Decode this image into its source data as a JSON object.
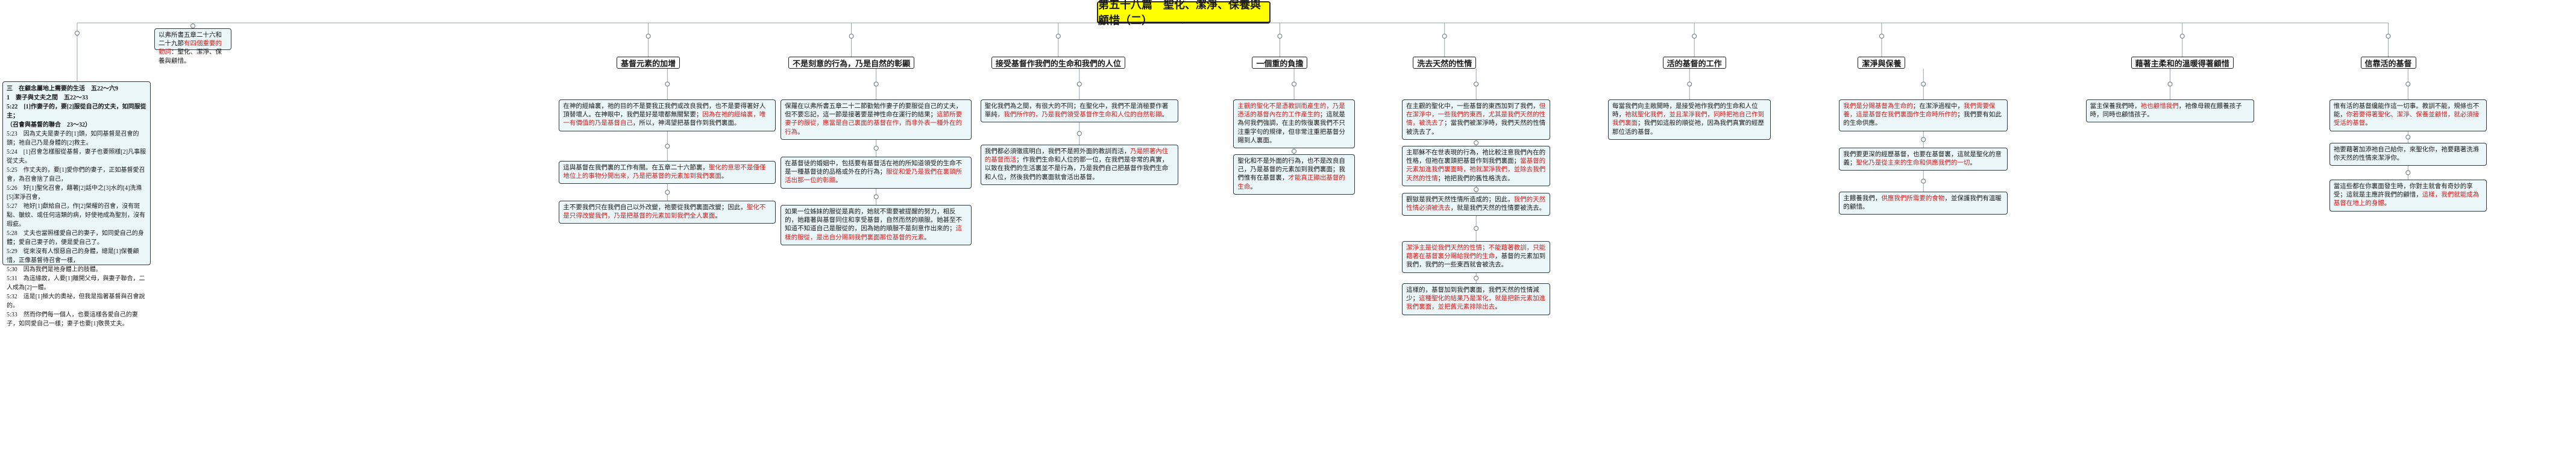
{
  "title": "第五十八篇　聖化、潔淨、保養與顧惜（二）",
  "left_block": {
    "lines": [
      "三　在顧念屬地上需要的生活　五22～六9",
      "1　妻子與丈夫之間　五22～33",
      "5:22　[1]作妻子的，要[2]服從自己的丈夫，如同服從主；",
      "（召會與基督的聯合　23～32）",
      "5:23　因為丈夫是妻子的[1]頭，如同基督是召會的頭；祂自己乃是身體的[2]救主。",
      "5:24　[1]召會怎樣服從基督，妻子也要照樣[2]凡事服從丈夫。",
      "5:25　作丈夫的，要[1]愛你們的妻子，正如基督愛召會，為召會捨了自己，",
      "5:26　好[1]聖化召會，藉著[2]話中之[3]水的[4]洗滌[5]潔淨召會，",
      "5:27　祂好[1]獻給自己，作[2]榮耀的召會，沒有斑點、皺紋、或任何這類的病，好使祂成為聖別，沒有瑕疵。",
      "5:28　丈夫也當照樣愛自己的妻子，如同愛自己的身體；愛自己妻子的，便是愛自己了。",
      "5:29　從來沒有人恨惡自己的身體，總是[1]保養顧惜，正像基督待召會一樣，",
      "5:30　因為我們是祂身體上的肢體。",
      "5:31　為這緣故，人要[1]離開父母，與妻子聯合，二人成為[2]一體。",
      "5:32　這是[1]極大的奧祕，但我是指著基督與召會說的。",
      "5:33　然而你們每一個人，也要這樣各愛自己的妻子，如同愛自己一樣；妻子也要[1]敬畏丈夫。"
    ]
  },
  "intro_box": {
    "text_a": "以弗所書五章二十六和二十九節",
    "text_red": "有四個重要的動詞",
    "text_b": "：聖化、潔淨、保養與顧惜。"
  },
  "branches": [
    {
      "head": "基督元素的加增",
      "boxes": [
        {
          "parts": [
            {
              "t": "在神的經綸裏，祂的目的不是要我正我們或改良我們，也不是要得著好人頂替壞人。在神眼中，我們是好是壞都無關緊要；"
            },
            {
              "t": "因為在祂的經綸裏，唯一有價值的乃是基督自己",
              "r": true
            },
            {
              "t": "，所以，神渴望把基督作到我們裏面。"
            }
          ]
        },
        {
          "parts": [
            {
              "t": "這與基督在我們裏的工作有關。在五章二十六節裏，"
            },
            {
              "t": "聖化的意思不是僅僅地位上的事物分開出來，乃是把基督的元素加到我們裏面",
              "r": true
            },
            {
              "t": "。"
            }
          ]
        },
        {
          "parts": [
            {
              "t": "主不要我們只在我們自己以外改變，祂要從我們裏面改變；因此，"
            },
            {
              "t": "聖化不是只得改變我們，乃是把基督的元素加到我們全人裏面",
              "r": true
            },
            {
              "t": "。"
            }
          ]
        }
      ]
    },
    {
      "head": "不是刻意的行為，乃是自然的彰顯",
      "boxes": [
        {
          "parts": [
            {
              "t": "保羅在以弗所書五章二十二節勸勉作妻子的要服從自己的丈夫，但不要忘記，這一節是接著要是神性命在運行的結果；"
            },
            {
              "t": "這節所要妻子的服從，應當是自己裏面的基督在作，而非外表一種外在的行為",
              "r": true
            },
            {
              "t": "。"
            }
          ]
        },
        {
          "parts": [
            {
              "t": "在基督徒的婚姻中，包括要有基督活在祂的所知道領受的生命不是一種基督徒的品格或外在的行為；"
            },
            {
              "t": "服從和愛乃是我們在裏頭所活出那一位的彰顯",
              "r": true
            },
            {
              "t": "。"
            }
          ]
        },
        {
          "parts": [
            {
              "t": "如果一位姊妹的服從是真的，她就不需要被提醒的努力，相反的，她藉著與基督同住和享受基督，自然而然的順服。她甚至不知道不知道自己是服從的，因為她的順服不是刻意作出來的；"
            },
            {
              "t": "這樣的服從，是出自分賜到我們裏面那位基督的元素",
              "r": true
            },
            {
              "t": "。"
            }
          ]
        }
      ]
    },
    {
      "head": "接受基督作我們的生命和我們的人位",
      "boxes": [
        {
          "parts": [
            {
              "t": "聖化我們為之間，有很大的不同；在聖化中，我們不是消極要作著單純"
            },
            {
              "t": "，我們所作的，乃是我們領受基督作生命和人位的自然彰顯",
              "r": true
            },
            {
              "t": "。"
            }
          ]
        },
        {
          "parts": [
            {
              "t": "我們都必須徹底明白，我們不是照外面的教訓而活，"
            },
            {
              "t": "乃是照著內住的基督而活",
              "r": true
            },
            {
              "t": "；作我們生命和人位的那一位，在我們是非常的真實，以致在我們的生活裏並不是行為，乃是我們自己把基督作我們生命和人位，然後我們的裏面就會活出基督。"
            }
          ]
        }
      ]
    },
    {
      "head": "一個重的負擔",
      "boxes": [
        {
          "parts": [
            {
              "t": "主觀的聖化不是憑教訓而產生的，乃是憑活的基督內在的工作產生的",
              "r": true
            },
            {
              "t": "；這就是為何我們強調，在主的恢復裏我們不只注重字句的規律，但非常注重把基督分賜到人裏面。"
            }
          ]
        },
        {
          "parts": [
            {
              "t": "聖化和不是外面的行為，也不是改良自己，乃是基督的元素加到我們裏面；我們惟有在基督裏，"
            },
            {
              "t": "才能真正顯出基督的生命",
              "r": true
            },
            {
              "t": "。"
            }
          ]
        }
      ]
    },
    {
      "head": "洗去天然的性情",
      "boxes": [
        {
          "parts": [
            {
              "t": "在主觀的聖化中，一些基督的東西加到了我們，"
            },
            {
              "t": "但在潔淨中，一些我們的東西，尤其是我們天然的性情，被洗去了",
              "r": true
            },
            {
              "t": "；當我們被潔淨時，我們天然的性情被洗去了。"
            }
          ]
        },
        {
          "parts": [
            {
              "t": "主耶穌不在世表現的行為，祂比較注意我們內在的性格，但祂在裏頭把基督作到我們裏面；"
            },
            {
              "t": "當基督的元素加進我們裏面時，祂就潔淨我們，並除去我們天然的性情",
              "r": true
            },
            {
              "t": "；祂把我們的舊性格洗去。"
            }
          ]
        },
        {
          "parts": [
            {
              "t": "觀獄是我們天然性情所造成的；因此，"
            },
            {
              "t": "我們的天然性情必須被洗去",
              "r": true
            },
            {
              "t": "，就是我們天然的性情要被洗去。"
            }
          ]
        },
        {
          "parts": [
            {
              "t": "潔淨主是從我們天然的性情；不能藉著教訓，只能藉著在基督裏分賜給我們的生命",
              "r": true
            },
            {
              "t": "，基督的元素加到我們，我們的一些東西就會被洗去。"
            }
          ]
        },
        {
          "parts": [
            {
              "t": "這樣的，基督加到我們裏面，我們天然的性情減少；"
            },
            {
              "t": "這種聖化的結果乃是潔化，就是把新元素加進我們裏面，並把舊元素排除出去",
              "r": true
            },
            {
              "t": "。"
            }
          ]
        }
      ]
    },
    {
      "head": "活的基督的工作",
      "boxes": [
        {
          "parts": [
            {
              "t": "每當我們向主敞開時，是接受祂作我們的生命和人位時，"
            },
            {
              "t": "祂就聖化我們，並且潔淨我們，同時把祂自己作到我們裏面",
              "r": true
            },
            {
              "t": "；我們如這般的順從祂，因為我們真實的經歷那位活的基督。"
            }
          ]
        }
      ]
    },
    {
      "head": "潔淨與保養",
      "boxes": [
        {
          "parts": [
            {
              "t": "我們是分賜基督為生命的",
              "r": true
            },
            {
              "t": "；在潔淨過程中，"
            },
            {
              "t": "我們需要保養，這是基督在我們裏面作生命時所作的",
              "r": true
            },
            {
              "t": "；我們要有如此的生命供應。"
            }
          ]
        },
        {
          "parts": [
            {
              "t": "我們要更深的經歷基督，也要在基督裏，這就是聖化的意義；"
            },
            {
              "t": "聖化乃是從主來的生命和供應我們的一切",
              "r": true
            },
            {
              "t": "。"
            }
          ]
        },
        {
          "parts": [
            {
              "t": "主餵養我們，"
            },
            {
              "t": "供應我們所需要的食物",
              "r": true
            },
            {
              "t": "，並保護我們有溫暖的顧惜。"
            }
          ]
        }
      ]
    },
    {
      "head": "藉著主柔和的溫暖得著顧惜",
      "boxes": [
        {
          "parts": [
            {
              "t": "當主保養我們時，"
            },
            {
              "t": "祂也顧惜我們",
              "r": true
            },
            {
              "t": "，祂像母親在餵養孩子時，同時也顧惜孩子。"
            }
          ]
        }
      ]
    },
    {
      "head": "信靠活的基督",
      "boxes": [
        {
          "parts": [
            {
              "t": "惟有活的基督纔能作這一切事。教訓不能，規條也不能，"
            },
            {
              "t": "你若要得著聖化、潔淨、保養並顧惜，就必須接受活的基督",
              "r": true
            },
            {
              "t": "。"
            }
          ]
        },
        {
          "parts": [
            {
              "t": "祂要藉著加添祂自己給你，來聖化你，祂要藉著洗滌你天然的性情來潔淨你。"
            }
          ]
        },
        {
          "parts": [
            {
              "t": "當這些都在你裏面發生時，你對主就會有奇妙的享受；這就是主應許我們的顧惜，"
            },
            {
              "t": "這樣，我們就能成為基督在地上的身體",
              "r": true
            },
            {
              "t": "。"
            }
          ]
        }
      ]
    }
  ]
}
